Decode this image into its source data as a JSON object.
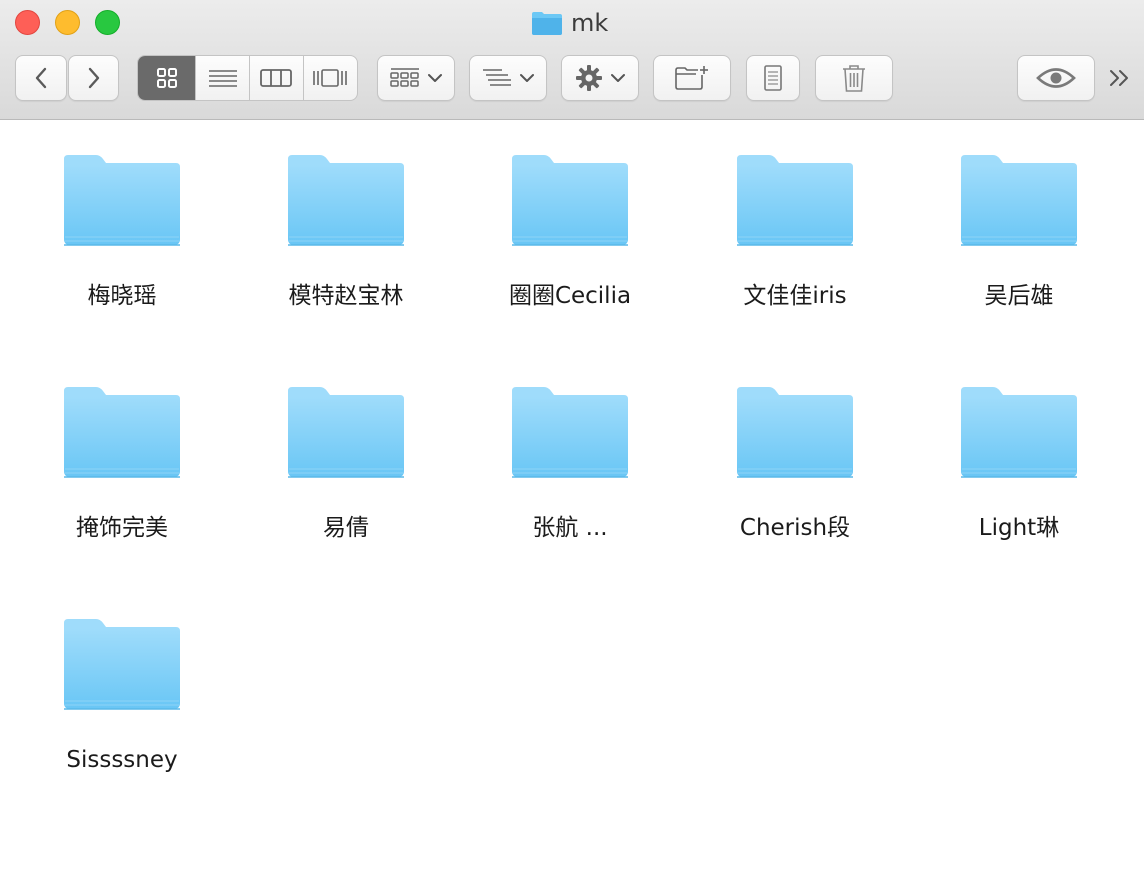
{
  "window": {
    "title": "mk",
    "title_icon": "folder-icon",
    "traffic_lights": [
      "close",
      "minimize",
      "zoom"
    ]
  },
  "toolbar": {
    "back_icon": "chevron-left-icon",
    "forward_icon": "chevron-right-icon",
    "view_modes": [
      {
        "name": "icon-view",
        "active": true
      },
      {
        "name": "list-view",
        "active": false
      },
      {
        "name": "column-view",
        "active": false
      },
      {
        "name": "cover-flow-view",
        "active": false
      }
    ],
    "buttons": [
      "arrange",
      "sort",
      "action-gear",
      "new-folder",
      "get-info",
      "trash",
      "quick-look",
      "more"
    ]
  },
  "colors": {
    "folder_light": "#9fdcfb",
    "folder_dark": "#69c6f5",
    "active_segment": "#6a6a6a"
  },
  "folders": [
    {
      "label": "梅晓瑶"
    },
    {
      "label": "模特赵宝林"
    },
    {
      "label": "圈圈Cecilia"
    },
    {
      "label": "文佳佳iris"
    },
    {
      "label": "吴后雄"
    },
    {
      "label": "掩饰完美"
    },
    {
      "label": "易倩"
    },
    {
      "label": "张航 ..."
    },
    {
      "label": "Cherish段"
    },
    {
      "label": "Light琳"
    },
    {
      "label": "Sissssney"
    }
  ]
}
